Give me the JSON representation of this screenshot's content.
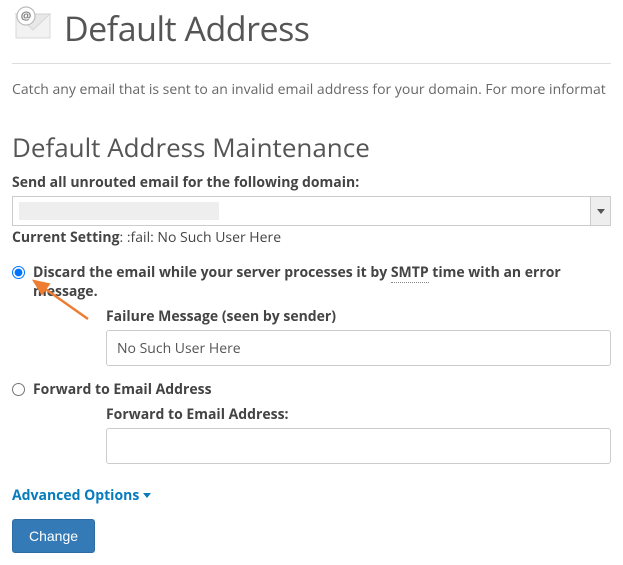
{
  "header": {
    "title": "Default Address"
  },
  "intro": "Catch any email that is sent to an invalid email address for your domain. For more informat",
  "maintenance": {
    "heading": "Default Address Maintenance",
    "domain_label": "Send all unrouted email for the following domain:",
    "current_label": "Current Setting",
    "current_value": ": :fail: No Such User Here"
  },
  "options": {
    "discard": {
      "label_pre": "Discard the email while your server processes it by ",
      "label_abbr": "SMTP",
      "label_post": " time with an error message.",
      "failure_label": "Failure Message (seen by sender)",
      "failure_value": "No Such User Here"
    },
    "forward": {
      "label": "Forward to Email Address",
      "sub_label": "Forward to Email Address:",
      "value": ""
    }
  },
  "advanced": "Advanced Options",
  "action": {
    "change": "Change"
  }
}
